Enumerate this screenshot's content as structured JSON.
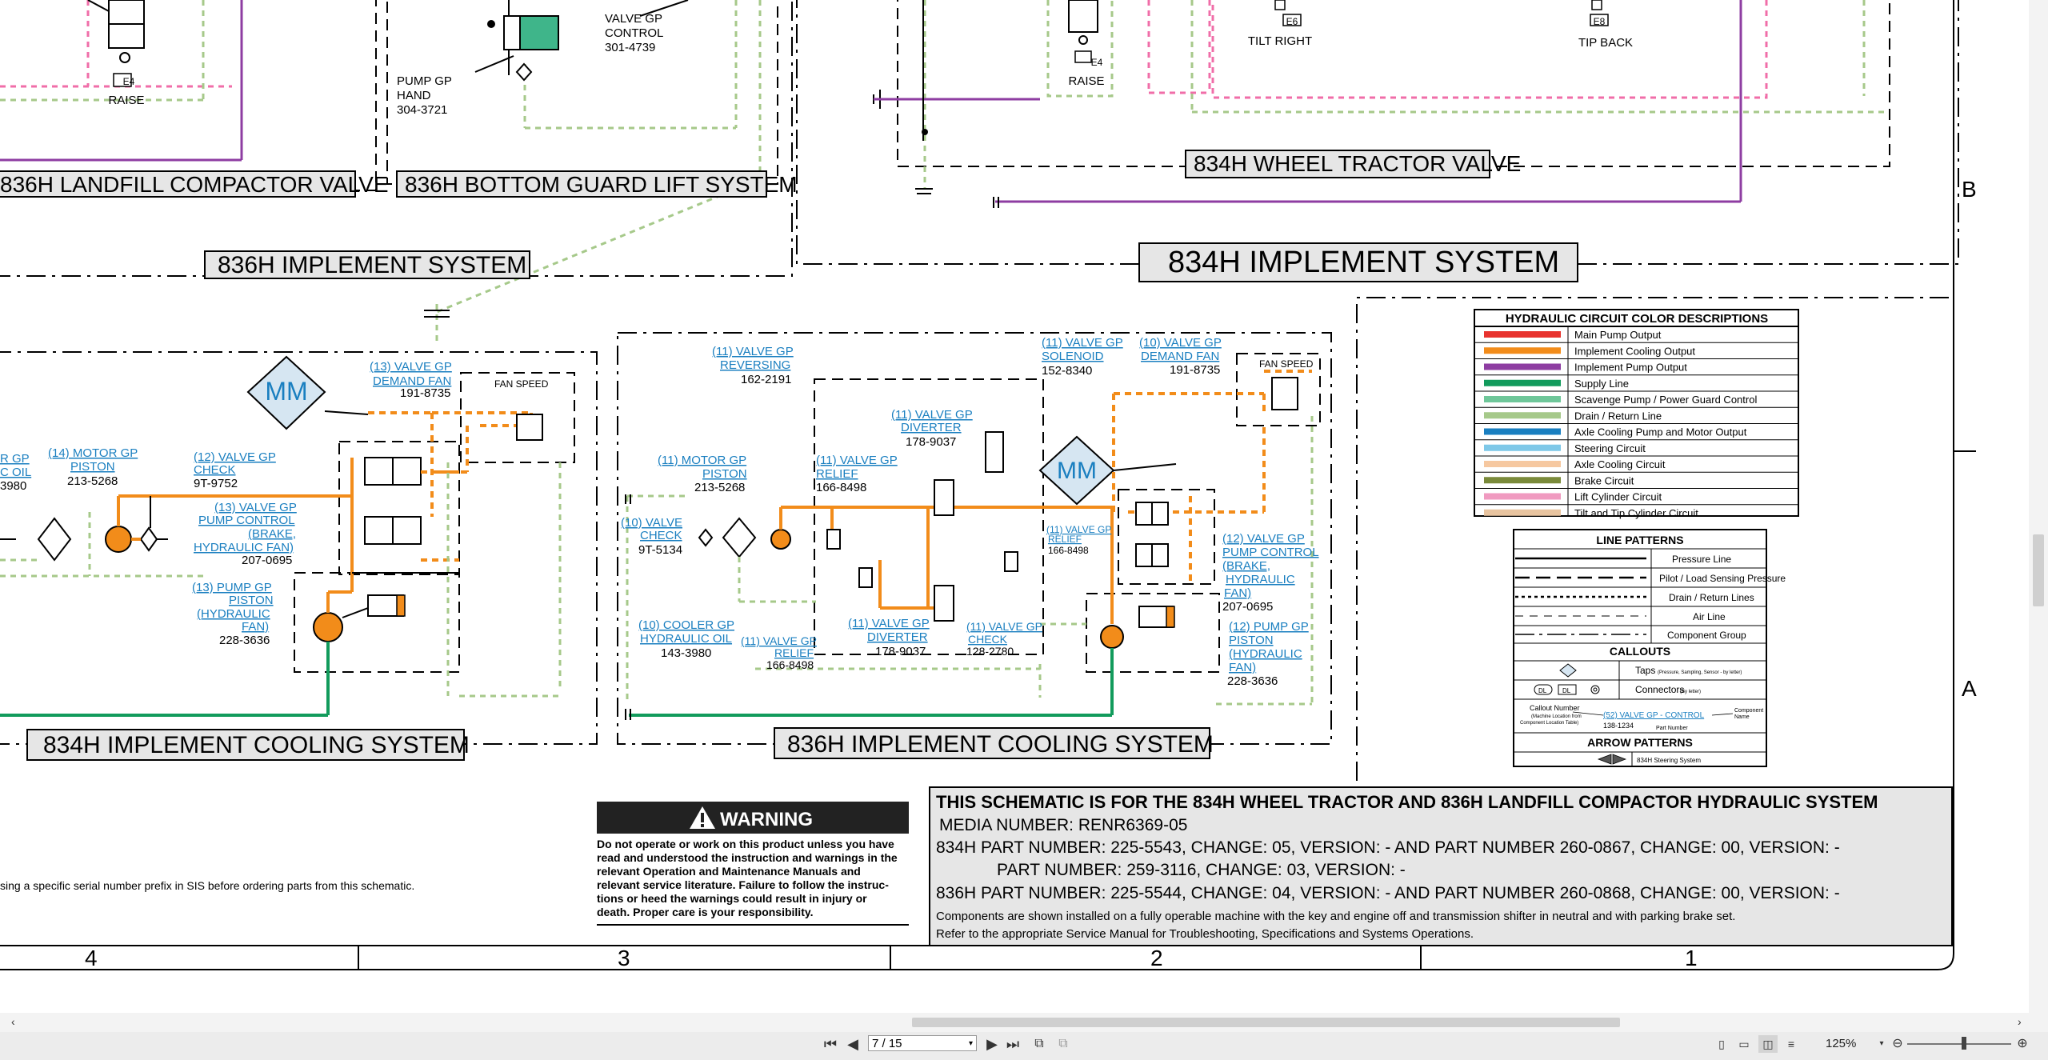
{
  "titles": {
    "landfill_valve": "836H LANDFILL COMPACTOR VALVE",
    "bottom_guard": "836H BOTTOM GUARD LIFT SYSTEM",
    "implement_836": "836H IMPLEMENT SYSTEM",
    "wheel_tractor_valve": "834H WHEEL TRACTOR VALVE",
    "implement_834": "834H IMPLEMENT SYSTEM",
    "cooling_834": "834H IMPLEMENT COOLING SYSTEM",
    "cooling_836": "836H IMPLEMENT COOLING SYSTEM"
  },
  "top_labels": {
    "e4_left": "E4",
    "raise_left": "RAISE",
    "pump_gp_hand_1": "PUMP GP",
    "pump_gp_hand_2": "HAND",
    "pump_gp_hand_3": "304-3721",
    "valve_gp_control_1": "VALVE GP",
    "valve_gp_control_2": "CONTROL",
    "valve_gp_control_3": "301-4739",
    "e4_right": "E4",
    "raise_right": "RAISE",
    "e6": "E6",
    "tilt_right": "TILT RIGHT",
    "e8": "E8",
    "tip_back": "TIP BACK"
  },
  "zones": {
    "b": "B",
    "a": "A"
  },
  "columns": [
    "4",
    "3",
    "2",
    "1"
  ],
  "left_cooling": {
    "mm": "MM",
    "v13_demand_1": "(13) VALVE GP",
    "v13_demand_2": "DEMAND FAN",
    "v13_demand_pn": "191-8735",
    "fan_speed": "FAN SPEED",
    "cooler_1": "R GP",
    "cooler_2": "C OIL",
    "cooler_pn": "3980",
    "motor_1": "(14) MOTOR GP",
    "motor_2": "PISTON",
    "motor_pn": "213-5268",
    "check_1": "(12) VALVE GP",
    "check_2": "CHECK",
    "check_pn": "9T-9752",
    "pumpctl_1": "(13) VALVE GP",
    "pumpctl_2": "PUMP CONTROL",
    "pumpctl_3": "(BRAKE,",
    "pumpctl_4": "HYDRAULIC FAN)",
    "pumpctl_pn": "207-0695",
    "pump_1": "(13) PUMP GP",
    "pump_2": "PISTON",
    "pump_3": "(HYDRAULIC",
    "pump_4": "FAN)",
    "pump_pn": "228-3636"
  },
  "right_cooling": {
    "mm": "MM",
    "reversing_1": "(11) VALVE GP",
    "reversing_2": "REVERSING",
    "reversing_pn": "162-2191",
    "solenoid_1": "(11) VALVE GP",
    "solenoid_2": "SOLENOID",
    "solenoid_pn": "152-8340",
    "demand_1": "(10) VALVE GP",
    "demand_2": "DEMAND FAN",
    "demand_pn": "191-8735",
    "fan_speed": "FAN SPEED",
    "diverter_a_1": "(11) VALVE GP",
    "diverter_a_2": "DIVERTER",
    "diverter_a_pn": "178-9037",
    "motor_1": "(11) MOTOR GP",
    "motor_2": "PISTON",
    "motor_pn": "213-5268",
    "relief_a_1": "(11) VALVE GP",
    "relief_a_2": "RELIEF",
    "relief_a_pn": "166-8498",
    "check10_1": "(10) VALVE",
    "check10_2": "CHECK",
    "check10_pn": "9T-5134",
    "relief_b_1": "(11) VALVE GP",
    "relief_b_2": "RELIEF",
    "relief_b_pn": "166-8498",
    "cooler_1": "(10) COOLER GP",
    "cooler_2": "HYDRAULIC OIL",
    "cooler_pn": "143-3980",
    "relief_c_1": "(11) VALVE GP",
    "relief_c_2": "RELIEF",
    "relief_c_pn": "166-8498",
    "diverter_b_1": "(11) VALVE GP",
    "diverter_b_2": "DIVERTER",
    "diverter_b_pn": "178-9037",
    "check11_1": "(11) VALVE GP",
    "check11_2": "CHECK",
    "check11_pn": "128-2780",
    "pumpctl_1": "(12) VALVE GP",
    "pumpctl_2": "PUMP CONTROL",
    "pumpctl_3": "(BRAKE,",
    "pumpctl_4": "HYDRAULIC",
    "pumpctl_5": "FAN)",
    "pumpctl_pn": "207-0695",
    "pump_1": "(12) PUMP GP",
    "pump_2": "PISTON",
    "pump_3": "(HYDRAULIC",
    "pump_4": "FAN)",
    "pump_pn": "228-3636"
  },
  "color_legend": {
    "title": "HYDRAULIC CIRCUIT COLOR DESCRIPTIONS",
    "items": [
      {
        "label": "Main Pump Output",
        "color": "#e8332e"
      },
      {
        "label": "Implement Cooling Output",
        "color": "#f28c1a"
      },
      {
        "label": "Implement Pump Output",
        "color": "#8e3da2"
      },
      {
        "label": "Supply Line",
        "color": "#129b5c"
      },
      {
        "label": "Scavenge Pump / Power Guard Control",
        "color": "#6fc79a"
      },
      {
        "label": "Drain / Return Line",
        "color": "#a6c98a"
      },
      {
        "label": "Axle Cooling Pump and Motor Output",
        "color": "#1a7fc0"
      },
      {
        "label": "Steering Circuit",
        "color": "#7ec8e8"
      },
      {
        "label": "Axle Cooling Circuit",
        "color": "#f6c8a0"
      },
      {
        "label": "Brake Circuit",
        "color": "#7a8a3a"
      },
      {
        "label": "Lift Cylinder Circuit",
        "color": "#f09ac0"
      },
      {
        "label": "Tilt and Tip Cylinder Circuit",
        "color": "#e8c4a0"
      }
    ]
  },
  "line_legend": {
    "title": "LINE PATTERNS",
    "items": [
      "Pressure Line",
      "Pilot / Load Sensing Pressure",
      "Drain / Return Lines",
      "Air Line",
      "Component Group"
    ],
    "callouts_title": "CALLOUTS",
    "taps": "Taps",
    "taps_note": "(Pressure, Sampling, Sensor - by letter)",
    "connectors": "Connectors",
    "connectors_note": "(By letter)",
    "dl1": "DL",
    "dl2": "DL",
    "callout_number": "Callout Number",
    "callout_note1": "(Machine Location from",
    "callout_note2": "Component Location Table)",
    "callout_example": "(52) VALVE GP - CONTROL",
    "callout_pn": "138-1234",
    "component_name_1": "Component",
    "component_name_2": "Name",
    "part_number": "Part Number",
    "arrow_title": "ARROW PATTERNS",
    "arrow_item": "834H Steering System"
  },
  "warning": {
    "title": "WARNING",
    "text1": "Do not operate or work on this product unless you have",
    "text2": "read and understood the instruction and warnings in the",
    "text3": "relevant Operation and Maintenance Manuals and",
    "text4": "relevant service literature. Failure to follow the instruc-",
    "text5": "tions or heed the warnings could result in injury or",
    "text6": "death. Proper care is your responsibility."
  },
  "serial_note": "sing a specific serial number prefix in SIS before ordering parts from this schematic.",
  "title_block": {
    "heading": "THIS SCHEMATIC IS FOR THE 834H WHEEL TRACTOR AND 836H LANDFILL COMPACTOR HYDRAULIC SYSTEM",
    "media": "MEDIA NUMBER: RENR6369-05",
    "line834a": "834H  PART NUMBER: 225-5543, CHANGE: 05, VERSION: -  AND  PART NUMBER 260-0867, CHANGE: 00, VERSION: -",
    "line834b": "PART NUMBER: 259-3116, CHANGE: 03, VERSION: -",
    "line836": "836H  PART NUMBER: 225-5544, CHANGE: 04, VERSION: -  AND  PART NUMBER 260-0868, CHANGE: 00, VERSION: -",
    "note1": "Components are shown installed on a fully operable machine with the key and engine off and transmission shifter in neutral and with parking brake set.",
    "note2": "Refer to the appropriate Service Manual for Troubleshooting, Specifications and Systems Operations."
  },
  "viewer": {
    "page": "7 / 15",
    "zoom": "125%"
  }
}
